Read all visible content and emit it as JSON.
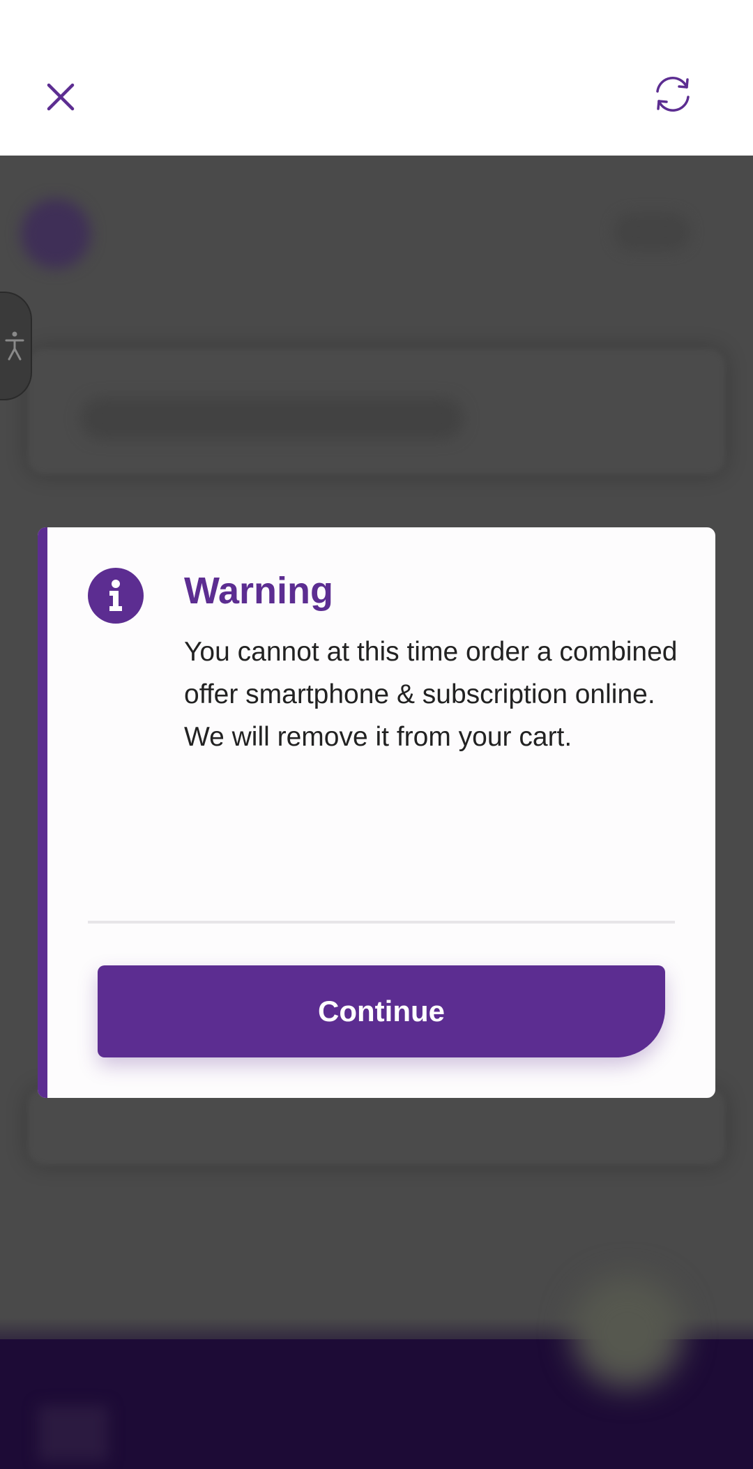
{
  "browser": {
    "close_icon": "close-icon",
    "refresh_icon": "refresh-icon"
  },
  "accessibility": {
    "icon": "accessibility-person-icon"
  },
  "modal": {
    "icon": "info-icon",
    "title": "Warning",
    "message": "You cannot at this time order a combined offer smartphone & subscription online. We will remove it from your cart.",
    "button_label": "Continue"
  },
  "colors": {
    "accent": "#5c2d91",
    "overlay": "#4a4a4a",
    "footer": "#1d0b36",
    "text": "#222222"
  }
}
